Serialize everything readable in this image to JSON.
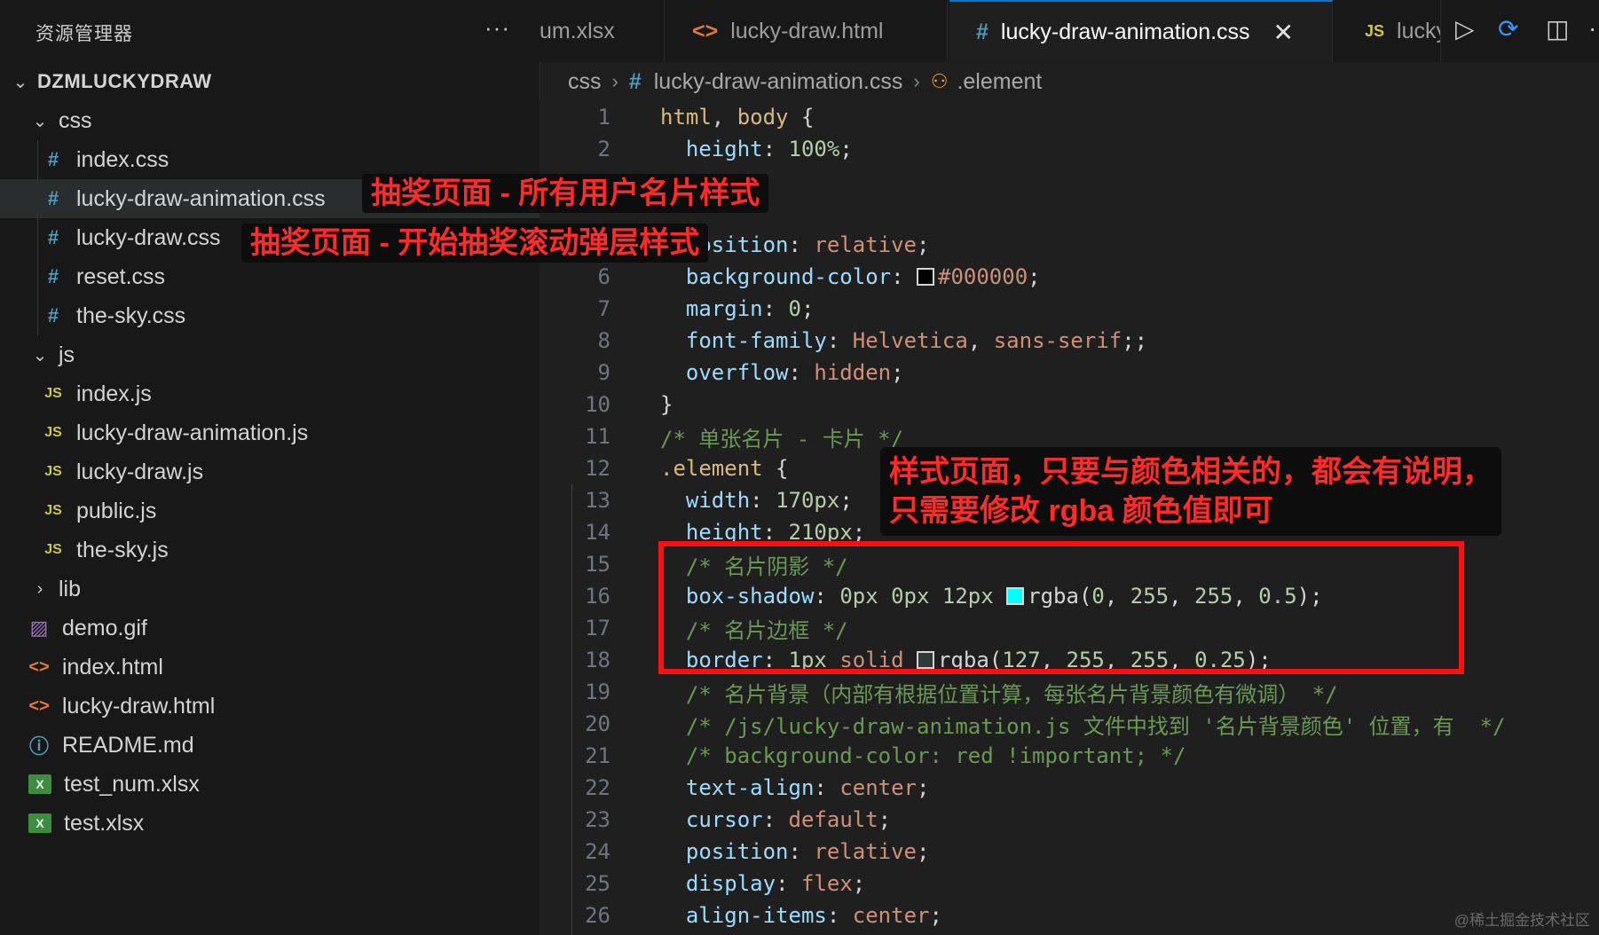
{
  "sidebar": {
    "title": "资源管理器",
    "more": "···",
    "root": "DZMLUCKYDRAW",
    "folders": {
      "css": "css",
      "js": "js",
      "lib": "lib"
    },
    "css_files": [
      "index.css",
      "lucky-draw-animation.css",
      "lucky-draw.css",
      "reset.css",
      "the-sky.css"
    ],
    "js_files": [
      "index.js",
      "lucky-draw-animation.js",
      "lucky-draw.js",
      "public.js",
      "the-sky.js"
    ],
    "root_files": [
      "demo.gif",
      "index.html",
      "lucky-draw.html",
      "README.md",
      "test_num.xlsx",
      "test.xlsx"
    ],
    "selected": "lucky-draw-animation.css",
    "icons": {
      "css": "#",
      "js": "JS",
      "html": "<>",
      "img": "image-icon",
      "info": "info-icon",
      "xls": "X"
    }
  },
  "tabs": [
    {
      "label": "um.xlsx",
      "icon": ""
    },
    {
      "label": "lucky-draw.html",
      "icon": "<>"
    },
    {
      "label": "lucky-draw-animation.css",
      "icon": "#",
      "active": true
    },
    {
      "label": "lucky",
      "icon": "JS"
    }
  ],
  "tab_close": "✕",
  "breadcrumb": {
    "folder": "css",
    "file": "lucky-draw-animation.css",
    "symbol": ".element"
  },
  "annotations": {
    "card_style": "抽奖页面 - 所有用户名片样式",
    "scroll_style": "抽奖页面 - 开始抽奖滚动弹层样式",
    "color_note_line1": "样式页面，只要与颜色相关的，都会有说明，",
    "color_note_line2": "只需要修改 rgba 颜色值即可"
  },
  "code_lines": [
    {
      "n": "1",
      "tokens": [
        [
          "t-sel",
          "html"
        ],
        [
          "t-pun",
          ", "
        ],
        [
          "t-sel",
          "body"
        ],
        [
          "t-pun",
          " {"
        ]
      ]
    },
    {
      "n": "2",
      "tokens": [
        [
          "t-pun",
          "  "
        ],
        [
          "t-prop",
          "height"
        ],
        [
          "t-pun",
          ": "
        ],
        [
          "t-num",
          "100%"
        ],
        [
          "t-pun",
          ";"
        ]
      ]
    },
    {
      "n": "5",
      "tokens": [
        [
          "t-pun",
          "  "
        ],
        [
          "t-prop",
          "position"
        ],
        [
          "t-pun",
          ": "
        ],
        [
          "t-val",
          "relative"
        ],
        [
          "t-pun",
          ";"
        ]
      ]
    },
    {
      "n": "6",
      "tokens": [
        [
          "t-pun",
          "  "
        ],
        [
          "t-prop",
          "background-color"
        ],
        [
          "t-pun",
          ": "
        ],
        [
          "swatch",
          "#000000"
        ],
        [
          "t-val",
          "#000000"
        ],
        [
          "t-pun",
          ";"
        ]
      ]
    },
    {
      "n": "7",
      "tokens": [
        [
          "t-pun",
          "  "
        ],
        [
          "t-prop",
          "margin"
        ],
        [
          "t-pun",
          ": "
        ],
        [
          "t-num",
          "0"
        ],
        [
          "t-pun",
          ";"
        ]
      ]
    },
    {
      "n": "8",
      "tokens": [
        [
          "t-pun",
          "  "
        ],
        [
          "t-prop",
          "font-family"
        ],
        [
          "t-pun",
          ": "
        ],
        [
          "t-val",
          "Helvetica"
        ],
        [
          "t-pun",
          ", "
        ],
        [
          "t-val",
          "sans-serif"
        ],
        [
          "t-pun",
          ";;"
        ]
      ]
    },
    {
      "n": "9",
      "tokens": [
        [
          "t-pun",
          "  "
        ],
        [
          "t-prop",
          "overflow"
        ],
        [
          "t-pun",
          ": "
        ],
        [
          "t-val",
          "hidden"
        ],
        [
          "t-pun",
          ";"
        ]
      ]
    },
    {
      "n": "10",
      "tokens": [
        [
          "t-pun",
          "}"
        ]
      ]
    },
    {
      "n": "11",
      "tokens": [
        [
          "t-com",
          "/* 单张名片 - 卡片 */"
        ]
      ]
    },
    {
      "n": "12",
      "tokens": [
        [
          "t-sel",
          ".element"
        ],
        [
          "t-pun",
          " {"
        ]
      ]
    },
    {
      "n": "13",
      "tokens": [
        [
          "t-pun",
          "  "
        ],
        [
          "t-prop",
          "width"
        ],
        [
          "t-pun",
          ": "
        ],
        [
          "t-num",
          "170px"
        ],
        [
          "t-pun",
          ";"
        ]
      ]
    },
    {
      "n": "14",
      "tokens": [
        [
          "t-pun",
          "  "
        ],
        [
          "t-prop",
          "height"
        ],
        [
          "t-pun",
          ": "
        ],
        [
          "t-num",
          "210px"
        ],
        [
          "t-pun",
          ";"
        ]
      ]
    },
    {
      "n": "15",
      "tokens": [
        [
          "t-pun",
          "  "
        ],
        [
          "t-com",
          "/* 名片阴影 */"
        ]
      ]
    },
    {
      "n": "16",
      "tokens": [
        [
          "t-pun",
          "  "
        ],
        [
          "t-prop",
          "box-shadow"
        ],
        [
          "t-pun",
          ": "
        ],
        [
          "t-num",
          "0px 0px 12px "
        ],
        [
          "swatch",
          "#00ffff"
        ],
        [
          "t-pun",
          "rgba("
        ],
        [
          "t-num",
          "0"
        ],
        [
          "t-pun",
          ", "
        ],
        [
          "t-num",
          "255"
        ],
        [
          "t-pun",
          ", "
        ],
        [
          "t-num",
          "255"
        ],
        [
          "t-pun",
          ", "
        ],
        [
          "t-num",
          "0.5"
        ],
        [
          "t-pun",
          ");"
        ]
      ]
    },
    {
      "n": "17",
      "tokens": [
        [
          "t-pun",
          "  "
        ],
        [
          "t-com",
          "/* 名片边框 */"
        ]
      ]
    },
    {
      "n": "18",
      "tokens": [
        [
          "t-pun",
          "  "
        ],
        [
          "t-prop",
          "border"
        ],
        [
          "t-pun",
          ": "
        ],
        [
          "t-num",
          "1px "
        ],
        [
          "t-val",
          "solid "
        ],
        [
          "swatch",
          "#2f3b3b"
        ],
        [
          "t-pun",
          "rgba("
        ],
        [
          "t-num",
          "127"
        ],
        [
          "t-pun",
          ", "
        ],
        [
          "t-num",
          "255"
        ],
        [
          "t-pun",
          ", "
        ],
        [
          "t-num",
          "255"
        ],
        [
          "t-pun",
          ", "
        ],
        [
          "t-num",
          "0.25"
        ],
        [
          "t-pun",
          ");"
        ]
      ]
    },
    {
      "n": "19",
      "tokens": [
        [
          "t-pun",
          "  "
        ],
        [
          "t-com",
          "/* 名片背景（内部有根据位置计算，每张名片背景颜色有微调） */"
        ]
      ]
    },
    {
      "n": "20",
      "tokens": [
        [
          "t-pun",
          "  "
        ],
        [
          "t-com",
          "/* /js/lucky-draw-animation.js 文件中找到 '名片背景颜色' 位置，有  */"
        ]
      ]
    },
    {
      "n": "21",
      "tokens": [
        [
          "t-pun",
          "  "
        ],
        [
          "t-com",
          "/* background-color: red !important; */"
        ]
      ]
    },
    {
      "n": "22",
      "tokens": [
        [
          "t-pun",
          "  "
        ],
        [
          "t-prop",
          "text-align"
        ],
        [
          "t-pun",
          ": "
        ],
        [
          "t-val",
          "center"
        ],
        [
          "t-pun",
          ";"
        ]
      ]
    },
    {
      "n": "23",
      "tokens": [
        [
          "t-pun",
          "  "
        ],
        [
          "t-prop",
          "cursor"
        ],
        [
          "t-pun",
          ": "
        ],
        [
          "t-val",
          "default"
        ],
        [
          "t-pun",
          ";"
        ]
      ]
    },
    {
      "n": "24",
      "tokens": [
        [
          "t-pun",
          "  "
        ],
        [
          "t-prop",
          "position"
        ],
        [
          "t-pun",
          ": "
        ],
        [
          "t-val",
          "relative"
        ],
        [
          "t-pun",
          ";"
        ]
      ]
    },
    {
      "n": "25",
      "tokens": [
        [
          "t-pun",
          "  "
        ],
        [
          "t-prop",
          "display"
        ],
        [
          "t-pun",
          ": "
        ],
        [
          "t-val",
          "flex"
        ],
        [
          "t-pun",
          ";"
        ]
      ]
    },
    {
      "n": "26",
      "tokens": [
        [
          "t-pun",
          "  "
        ],
        [
          "t-prop",
          "align-items"
        ],
        [
          "t-pun",
          ": "
        ],
        [
          "t-val",
          "center"
        ],
        [
          "t-pun",
          ";"
        ]
      ]
    }
  ],
  "watermark": "@稀土掘金技术社区",
  "colors": {
    "accent": "#0078d4",
    "annotation": "#ff2a2a",
    "highlight_box": "#ff1010"
  }
}
